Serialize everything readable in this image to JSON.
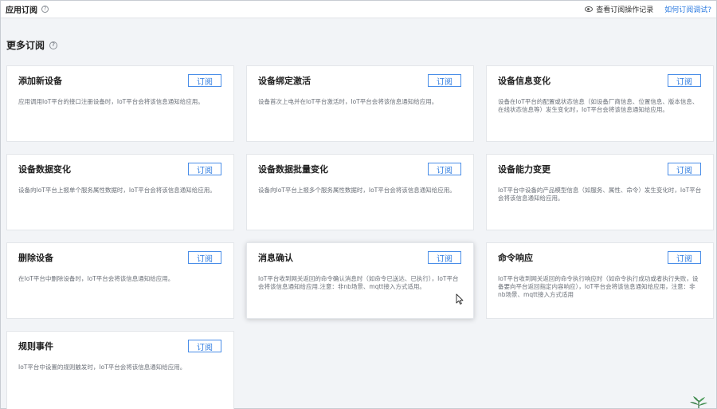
{
  "header": {
    "title": "应用订阅",
    "view_records": "查看订阅操作记录",
    "how_to_debug": "如何订阅调试?"
  },
  "section": {
    "title": "更多订阅"
  },
  "subscribe_label": "订阅",
  "cards": [
    {
      "title": "添加新设备",
      "desc": "应用调用IoT平台的接口注册设备时，IoT平台会将该信息通知给应用。"
    },
    {
      "title": "设备绑定激活",
      "desc": "设备首次上电并在IoT平台激活时，IoT平台会将该信息通知给应用。"
    },
    {
      "title": "设备信息变化",
      "desc": "设备在IoT平台的配置或状态信息（如设备厂商信息、位置信息、版本信息、在线状态信息等）发生变化时，IoT平台会将该信息通知给应用。"
    },
    {
      "title": "设备数据变化",
      "desc": "设备向IoT平台上报单个服务属性数据时，IoT平台会将该信息通知给应用。"
    },
    {
      "title": "设备数据批量变化",
      "desc": "设备向IoT平台上报多个服务属性数据时，IoT平台会将该信息通知给应用。"
    },
    {
      "title": "设备能力变更",
      "desc": "IoT平台中设备的产品模型信息（如服务、属性、命令）发生变化时，IoT平台会将该信息通知给应用。"
    },
    {
      "title": "删除设备",
      "desc": "在IoT平台中删除设备时，IoT平台会将该信息通知给应用。"
    },
    {
      "title": "消息确认",
      "desc": "IoT平台收到网关返回的命令确认消息时（如命令已送达、已执行），IoT平台会将该信息通知给应用.注意：非nb场景、mqtt接入方式适用。"
    },
    {
      "title": "命令响应",
      "desc": "IoT平台收到网关返回的命令执行响应时（如命令执行成功或者执行失败，设备要向平台返回指定内容响应），IoT平台会将该信息通知给应用，注意：非nb场景、mqtt接入方式适用"
    },
    {
      "title": "规则事件",
      "desc": "IoT平台中设置的规则触发时，IoT平台会将该信息通知给应用。"
    }
  ]
}
